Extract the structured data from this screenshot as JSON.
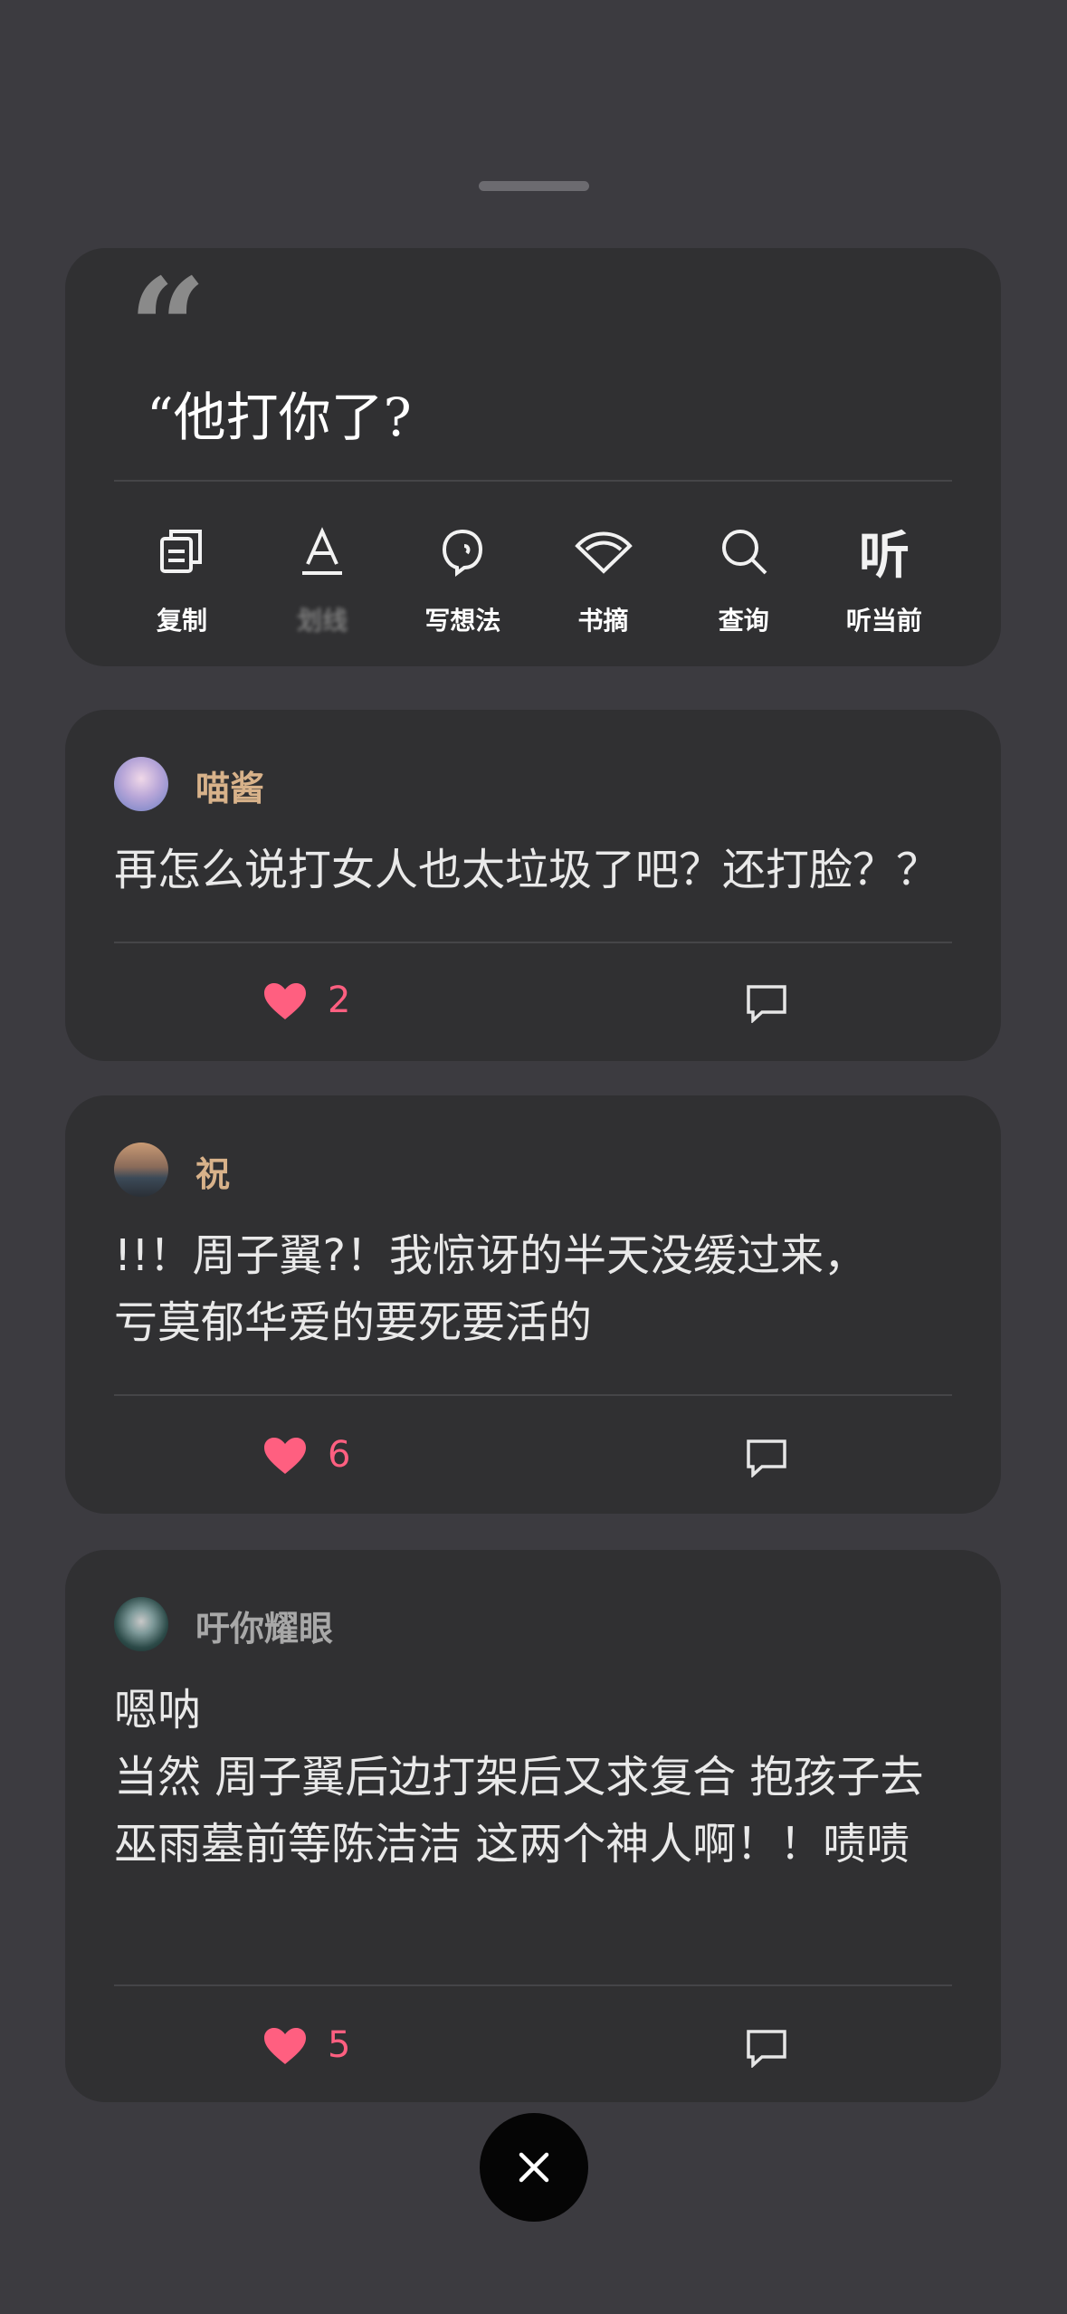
{
  "quote": {
    "text": "“他打你了?"
  },
  "actions": [
    {
      "label": "复制",
      "icon": "copy-icon"
    },
    {
      "label": "划线",
      "icon": "underline-icon"
    },
    {
      "label": "写想法",
      "icon": "thought-icon"
    },
    {
      "label": "书摘",
      "icon": "bookmark-fan-icon"
    },
    {
      "label": "查询",
      "icon": "search-icon"
    },
    {
      "label": "听当前",
      "icon": "listen-icon"
    }
  ],
  "comments": [
    {
      "user": "喵酱",
      "user_color": "#d8b28a",
      "text": "再怎么说打女人也太垃圾了吧？还打脸？？",
      "likes": "2"
    },
    {
      "user": "祝",
      "user_color": "#d8b28a",
      "text": "!!！周子翼?！我惊讶的半天没缓过来，\n亏莫郁华爱的要死要活的",
      "likes": "6"
    },
    {
      "user": "吁你耀眼",
      "user_color": "#a8a8a8",
      "text": "嗯呐\n当然 周子翼后边打架后又求复合 抱孩子去巫雨墓前等陈洁洁 这两个神人啊！！啧啧",
      "likes": "5"
    }
  ],
  "colors": {
    "background": "#3c3b40",
    "card": "#303032",
    "like": "#ff5f80"
  }
}
